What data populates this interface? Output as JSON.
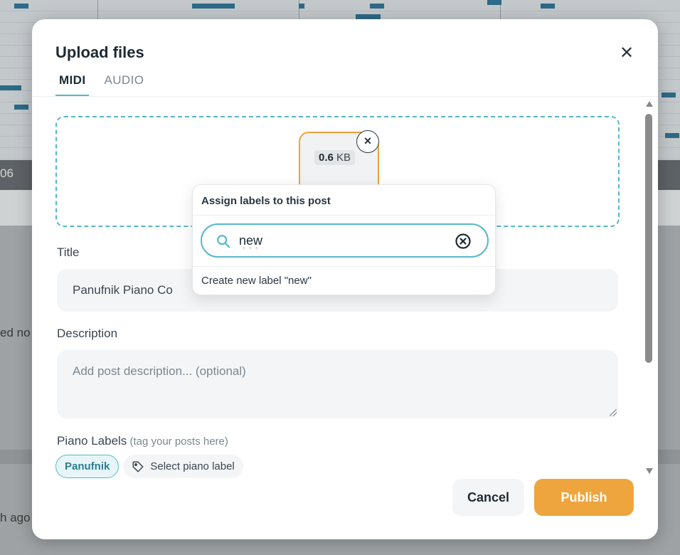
{
  "background": {
    "timeline_label": "06",
    "list_snippet_1": "ed no",
    "list_snippet_2": "h ago"
  },
  "modal": {
    "title": "Upload files",
    "close_icon": "close-icon",
    "tabs": [
      {
        "label": "MIDI",
        "active": true
      },
      {
        "label": "AUDIO",
        "active": false
      }
    ],
    "file": {
      "size_value": "0.6",
      "size_unit": " KB",
      "remove_icon": "close-icon"
    },
    "title_field": {
      "label": "Title",
      "value": "Panufnik Piano Co"
    },
    "description_field": {
      "label": "Description",
      "placeholder": "Add post description... (optional)"
    },
    "piano_labels": {
      "label": "Piano Labels",
      "hint": " (tag your posts here)",
      "chips": [
        {
          "label": "Panufnik"
        }
      ],
      "select_label": "Select piano label",
      "select_icon": "tag-icon"
    },
    "buttons": {
      "cancel": "Cancel",
      "publish": "Publish"
    },
    "colors": {
      "accent_teal": "#56b8c9",
      "publish_orange": "#eea53e",
      "file_border_orange": "#f0a23a"
    }
  },
  "label_popover": {
    "title": "Assign labels to this post",
    "search_value": "new",
    "search_icon": "search-icon",
    "clear_icon": "clear-circle-icon",
    "create_option": "Create new label \"new\""
  }
}
